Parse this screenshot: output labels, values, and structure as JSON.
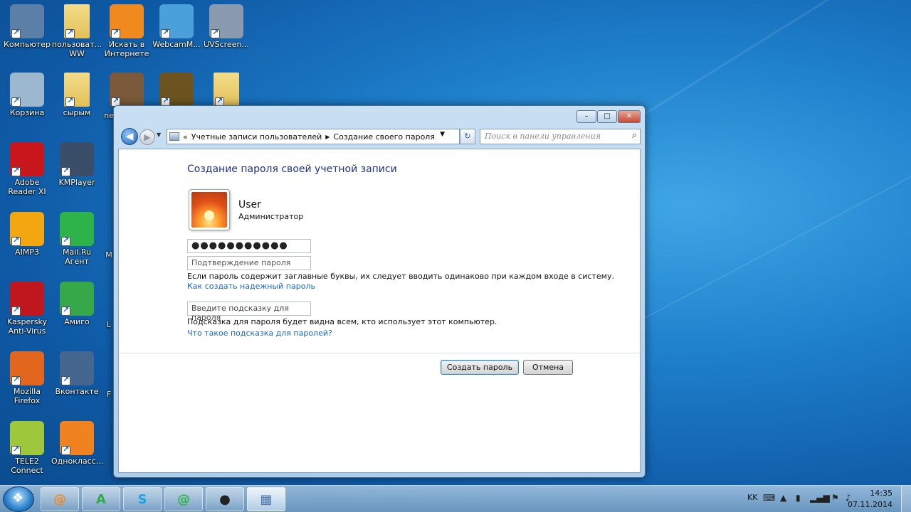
{
  "desktop": {
    "icons": [
      {
        "label": "Компьютер",
        "icon": "computer-icon",
        "color": "#5b7fa6"
      },
      {
        "label": "пользоват... WW",
        "icon": "folder-icon",
        "color": "#e3c15a"
      },
      {
        "label": "Искать в Интернете",
        "icon": "search-web-icon",
        "color": "#f08a1e"
      },
      {
        "label": "WebcamM...",
        "icon": "webcam-icon",
        "color": "#4aa0d8"
      },
      {
        "label": "UVScreen...",
        "icon": "screen-capture-icon",
        "color": "#8a9bb0"
      },
      {
        "label": "Корзина",
        "icon": "recycle-bin-icon",
        "color": "#9cb8cf"
      },
      {
        "label": "сырым",
        "icon": "folder-icon",
        "color": "#e3c15a"
      },
      {
        "label": "Me",
        "icon": "media-icon",
        "color": "#7a5a3a"
      },
      {
        "label": "",
        "icon": "game-icon",
        "color": "#6d5320"
      },
      {
        "label": "",
        "icon": "folder-icon",
        "color": "#e3c15a"
      },
      {
        "label": "Adobe Reader XI",
        "icon": "adobe-reader-icon",
        "color": "#c8161d"
      },
      {
        "label": "KMPlayer",
        "icon": "kmplayer-icon",
        "color": "#3a4e6a"
      },
      {
        "label": "AIMP3",
        "icon": "aimp-icon",
        "color": "#f3a60f"
      },
      {
        "label": "Mail.Ru Агент",
        "icon": "mailru-agent-icon",
        "color": "#2eb24a"
      },
      {
        "label": "Kaspersky Anti-Virus",
        "icon": "kaspersky-icon",
        "color": "#c0171f"
      },
      {
        "label": "Амиго",
        "icon": "amigo-icon",
        "color": "#36a84a"
      },
      {
        "label": "Mozilla Firefox",
        "icon": "firefox-icon",
        "color": "#e2661d"
      },
      {
        "label": "Вконтакте",
        "icon": "vk-icon",
        "color": "#45668e"
      },
      {
        "label": "TELE2 Connect",
        "icon": "tele2-icon",
        "color": "#9fc73b"
      },
      {
        "label": "Однокласс...",
        "icon": "odnoklassniki-icon",
        "color": "#f18220"
      }
    ],
    "partial_labels": [
      "ne",
      "M",
      "L",
      "F"
    ]
  },
  "window": {
    "controls": {
      "minimize": "–",
      "maximize": "□",
      "close": "✕"
    },
    "breadcrumb": {
      "prefix": "«",
      "parent": "Учетные записи пользователей",
      "separator": "▶",
      "current": "Создание своего пароля"
    },
    "search_placeholder": "Поиск в панели управления",
    "title": "Создание пароля своей учетной записи",
    "user": {
      "name": "User",
      "role": "Администратор"
    },
    "password_value": "●●●●●●●●●●●",
    "confirm_placeholder": "Подтверждение пароля",
    "caps_note": "Если пароль содержит заглавные буквы, их следует вводить одинаково при каждом входе в систему.",
    "strong_link": "Как создать надежный пароль",
    "hint_placeholder": "Введите подсказку для пароля",
    "hint_note": "Подсказка для пароля будет видна всем, кто использует этот компьютер.",
    "hint_link": "Что такое подсказка для паролей?",
    "create_button": "Создать пароль",
    "cancel_button": "Отмена"
  },
  "taskbar": {
    "buttons": [
      {
        "icon": "mailru-agent-icon",
        "glyph": "@",
        "color": "#f08a1e"
      },
      {
        "icon": "amigo-icon",
        "glyph": "A",
        "color": "#36a84a"
      },
      {
        "icon": "skype-icon",
        "glyph": "S",
        "color": "#1aa3e0"
      },
      {
        "icon": "mailru-agent-icon",
        "glyph": "@",
        "color": "#2eb24a"
      },
      {
        "icon": "obs-icon",
        "glyph": "●",
        "color": "#222222"
      },
      {
        "icon": "control-panel-icon",
        "glyph": "▦",
        "color": "#4a78b0"
      }
    ],
    "lang": "KK",
    "time": "14:35",
    "date": "07.11.2014"
  }
}
